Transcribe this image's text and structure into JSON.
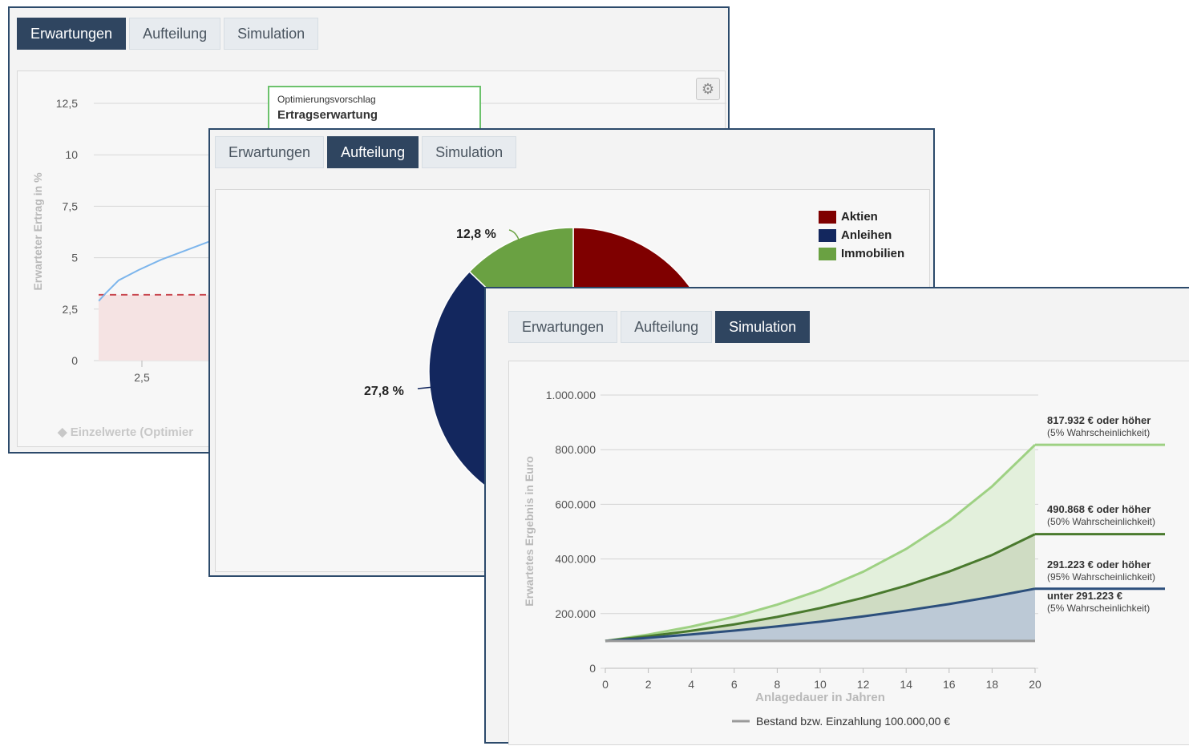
{
  "tabs": [
    "Erwartungen",
    "Aufteilung",
    "Simulation"
  ],
  "panel1": {
    "active_tab": 0,
    "chart_data": {
      "type": "line",
      "ylabel": "Erwarteter Ertrag in %",
      "y_ticks": [
        "12,5",
        "10",
        "7,5",
        "5",
        "2,5",
        "0"
      ],
      "y_values": [
        12.5,
        10,
        7.5,
        5,
        2.5,
        0
      ],
      "ylim": [
        0,
        12.5
      ],
      "x_ticks": [
        "2,5"
      ],
      "reference_line": 3.2,
      "curve_x": [
        0.7,
        1.0,
        1.5,
        2.3,
        3.2,
        4.3,
        5.4
      ],
      "curve_y": [
        2.9,
        3.3,
        3.9,
        4.4,
        4.9,
        5.4,
        5.9
      ],
      "legend": "Einzelwerte (Optimier"
    },
    "tooltip": {
      "title": "Optimierungsvorschlag",
      "value": "Ertragserwartung"
    },
    "gear_icon": "gear-icon"
  },
  "panel2": {
    "active_tab": 1,
    "chart_data": {
      "type": "pie",
      "slices": [
        {
          "name": "Aktien",
          "color": "#7f0000"
        },
        {
          "name": "Anleihen",
          "color": "#13275e",
          "label": "27,8 %"
        },
        {
          "name": "Immobilien",
          "color": "#6aa142",
          "label": "12,8 %"
        }
      ]
    }
  },
  "panel3": {
    "active_tab": 2,
    "chart_data": {
      "type": "area",
      "ylabel": "Erwartetes Ergebnis in Euro",
      "xlabel": "Anlagedauer in Jahren",
      "y_ticks": [
        "1.000.000",
        "800.000",
        "600.000",
        "400.000",
        "200.000",
        "0"
      ],
      "y_values": [
        1000000,
        800000,
        600000,
        400000,
        200000,
        0
      ],
      "ylim": [
        0,
        1000000
      ],
      "x_ticks": [
        "0",
        "2",
        "4",
        "6",
        "8",
        "10",
        "12",
        "14",
        "16",
        "18",
        "20"
      ],
      "x": [
        0,
        2,
        4,
        6,
        8,
        10,
        12,
        14,
        16,
        18,
        20
      ],
      "xlim": [
        0,
        20
      ],
      "series": [
        {
          "name": "5% Wahrscheinlichkeit",
          "color": "#9ed183",
          "fill": "#e3f0dc",
          "values": [
            100000,
            123300,
            152500,
            188400,
            232900,
            286000,
            353300,
            436600,
            539400,
            665700,
            817932
          ]
        },
        {
          "name": "50% Wahrscheinlichkeit",
          "color": "#4a7a2e",
          "fill": "#cfdcc3",
          "values": [
            100000,
            117200,
            137000,
            160500,
            188000,
            220300,
            258000,
            302200,
            354000,
            414700,
            490868
          ]
        },
        {
          "name": "95% Wahrscheinlichkeit",
          "color": "#2c4f7c",
          "fill": "#bcc9d6",
          "values": [
            100000,
            111300,
            123900,
            137700,
            153300,
            170600,
            189900,
            211300,
            235100,
            261800,
            291223
          ]
        },
        {
          "name": "Bestand bzw. Einzahlung 100.000,00 €",
          "color": "#9a9a9a",
          "values": [
            100000,
            100000,
            100000,
            100000,
            100000,
            100000,
            100000,
            100000,
            100000,
            100000,
            100000
          ]
        }
      ],
      "annotations": [
        {
          "label": "817.932 € oder höher",
          "sub": "(5% Wahrscheinlichkeit)",
          "value": 817932,
          "color": "#9ed183"
        },
        {
          "label": "490.868 € oder höher",
          "sub": "(50% Wahrscheinlichkeit)",
          "value": 490868,
          "color": "#4a7a2e"
        },
        {
          "label": "291.223 € oder höher",
          "sub": "(95% Wahrscheinlichkeit)",
          "value": 291223,
          "color": "#2c4f7c"
        },
        {
          "label": "unter 291.223 €",
          "sub": "(5% Wahrscheinlichkeit)",
          "value": 291223,
          "color": "#2c4f7c"
        }
      ],
      "legend": "Bestand bzw. Einzahlung 100.000,00 €"
    }
  }
}
